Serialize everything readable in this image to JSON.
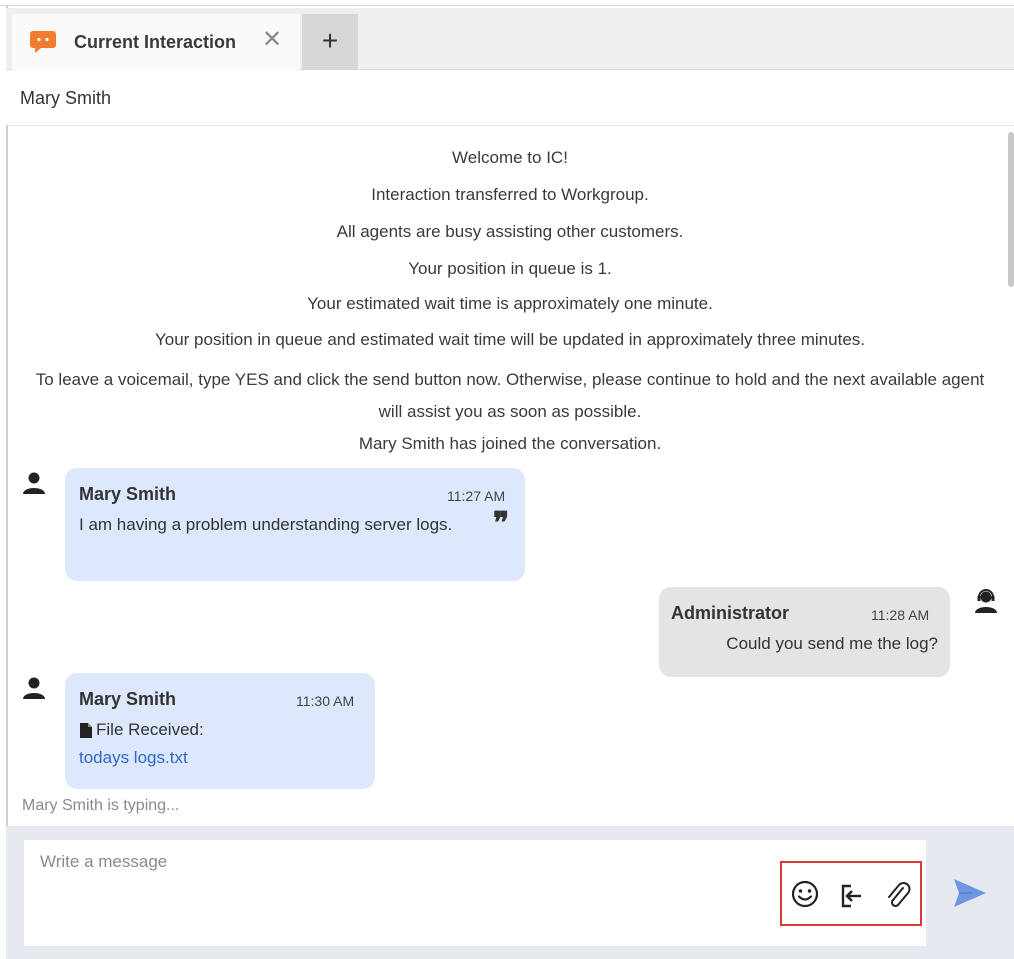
{
  "tabs": {
    "active_label": "Current Interaction",
    "close_symbol": "✕",
    "add_symbol": "+"
  },
  "header": {
    "contact_name": "Mary Smith"
  },
  "system_messages": [
    "Welcome to IC!",
    "Interaction transferred to Workgroup.",
    "All agents are busy assisting other customers.",
    "Your position in queue is 1.",
    "Your estimated wait time is approximately one minute.",
    "Your position in queue and estimated wait time will be updated in approximately three minutes.",
    "To leave a voicemail, type YES and click the send button now.  Otherwise, please continue to hold and the next available agent will assist you as soon as possible.",
    "Mary  Smith has joined the conversation."
  ],
  "messages": [
    {
      "sender": "Mary Smith",
      "time": "11:27 AM",
      "text": "I am having a problem understanding server logs.",
      "role": "customer"
    },
    {
      "sender": "Administrator",
      "time": "11:28 AM",
      "text": "Could you send me the log?",
      "role": "agent"
    },
    {
      "sender": "Mary Smith",
      "time": "11:30 AM",
      "file_label": "File Received:",
      "file_name": "todays logs.txt",
      "role": "customer"
    }
  ],
  "typing_indicator": "Mary Smith is typing...",
  "composer": {
    "placeholder": "Write a message",
    "tools": [
      "emoji-icon",
      "exit-icon",
      "attachment-icon"
    ],
    "send_icon": "send-icon"
  },
  "colors": {
    "customer_bubble": "#dde8fd",
    "agent_bubble": "#e4e4e4",
    "tab_icon": "#f07d2f",
    "send": "#6f97e0",
    "highlight": "#d93a3a",
    "link": "#2f67c7"
  }
}
